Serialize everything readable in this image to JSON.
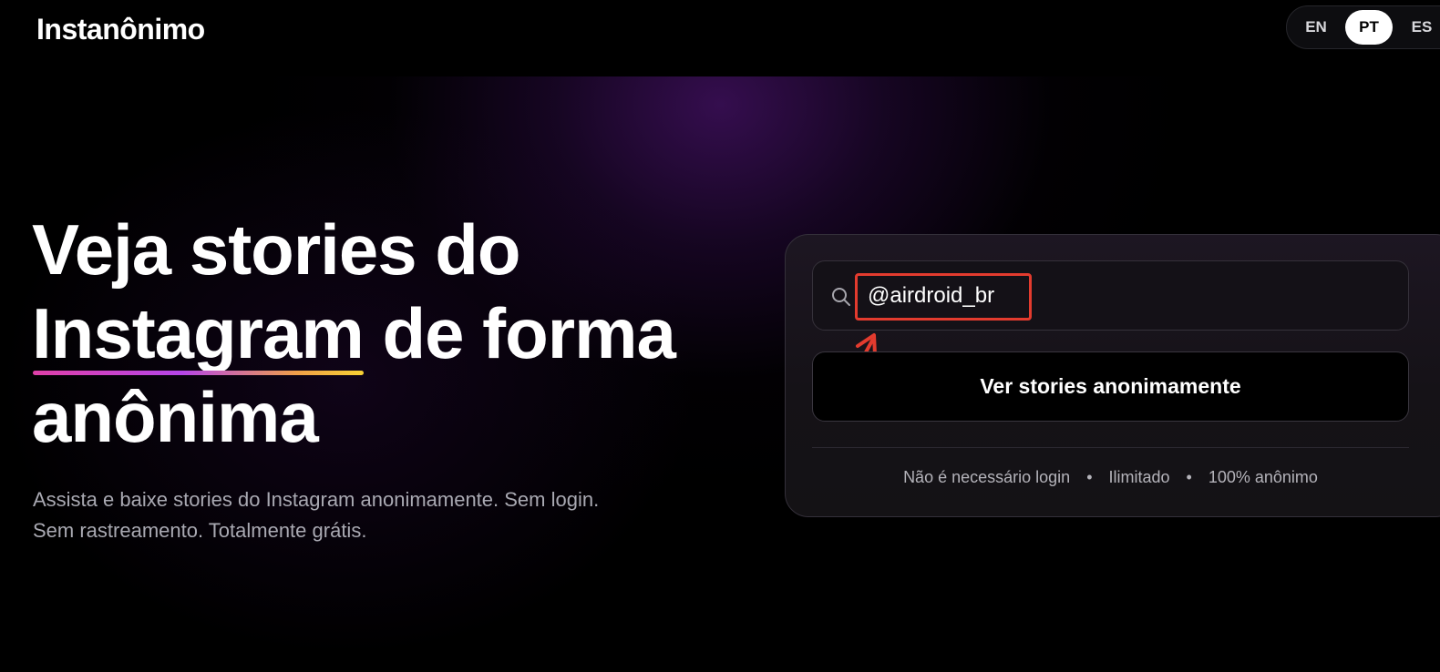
{
  "header": {
    "logo_text": "Instanônimo",
    "languages": [
      {
        "code": "EN",
        "active": false
      },
      {
        "code": "PT",
        "active": true
      },
      {
        "code": "ES",
        "active": false
      }
    ]
  },
  "hero": {
    "line1": "Veja stories do",
    "line2_highlight": "Instagram",
    "line2_rest": " de forma",
    "line3": "anônima",
    "subtitle": "Assista e baixe stories do Instagram anonimamente. Sem login. Sem rastreamento. Totalmente grátis."
  },
  "search": {
    "value": "@airdroid_br",
    "icon": "search-icon",
    "submit_label": "Ver stories anonimamente"
  },
  "features": {
    "items": [
      "Não é necessário login",
      "Ilimitado",
      "100% anônimo"
    ],
    "separator": "•"
  },
  "annotation": {
    "highlight_color": "#e33b2e"
  },
  "colors": {
    "background": "#000000",
    "glow": "#3e105c",
    "underline_gradient": [
      "#e040a8",
      "#b545e8",
      "#f0a048",
      "#f7d233"
    ],
    "card_border": "#34303a"
  }
}
